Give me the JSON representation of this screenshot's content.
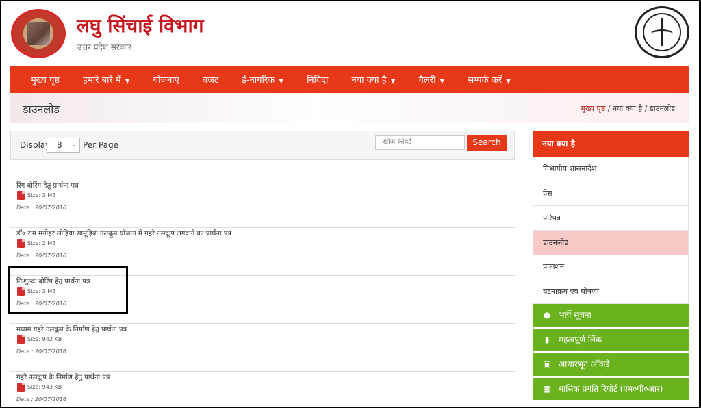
{
  "header": {
    "title": "लघु सिंचाई विभाग",
    "subtitle": "उत्तर प्रदेश सरकार"
  },
  "nav": {
    "items": [
      {
        "label": "मुख्य पृष्ठ",
        "dropdown": false
      },
      {
        "label": "हमारे बारे में",
        "dropdown": true
      },
      {
        "label": "योजनाएं",
        "dropdown": false
      },
      {
        "label": "बजट",
        "dropdown": false
      },
      {
        "label": "ई-नागरिक",
        "dropdown": true
      },
      {
        "label": "निविदा",
        "dropdown": false
      },
      {
        "label": "नया क्या है",
        "dropdown": true
      },
      {
        "label": "गैलरी",
        "dropdown": true
      },
      {
        "label": "सम्पर्क करें",
        "dropdown": true
      }
    ],
    "caret": "▼"
  },
  "page": {
    "title": "डाउनलोड",
    "breadcrumb": {
      "home": "मुख्य पृष्ठ",
      "rest": " / नया क्या है / डाउनलोड"
    }
  },
  "filter": {
    "display_label": "Display",
    "display_value": "8",
    "per_page_label": "Per Page",
    "search_placeholder": "खोज कीवर्ड",
    "search_button": "Search"
  },
  "documents": [
    {
      "title": "रिंग बोरिंग हेतु प्रार्थना पत्र",
      "size": "Size: 3 MB",
      "date": "Date : 20/07/2016"
    },
    {
      "title": "डॉ० राम मनोहर लोहिया सामूहिक नलकूप योजना में गहरे नलकूप लगवाने का प्रार्थना पत्र",
      "size": "Size: 2 MB",
      "date": "Date : 20/07/2016"
    },
    {
      "title": "निःशुल्क बोरिंग हेतु प्रार्थना पत्र",
      "size": "Size: 3 MB",
      "date": "Date : 20/07/2016"
    },
    {
      "title": "मध्यम गहरे नलकूप के निर्माण हेतु प्रार्थना पत्र",
      "size": "Size: 942 KB",
      "date": "Date : 20/07/2016"
    },
    {
      "title": "गहरे नलकूप के निर्माण हेतु प्रार्थना पत्र",
      "size": "Size: 943 KB",
      "date": "Date : 20/07/2016"
    }
  ],
  "sidebar": {
    "heading": "नया क्या है",
    "links": [
      "विभागीय शासनादेश",
      "प्रेस",
      "परिपत्र",
      "डाउनलोड",
      "प्रकाशन",
      "घटनाक्रम एवं घोषणा"
    ],
    "active_link": "डाउनलोड",
    "green_items": [
      {
        "label": "भर्ती सूचना",
        "icon": "user-icon"
      },
      {
        "label": "महत्वपूर्ण लिंक",
        "icon": "book-icon"
      },
      {
        "label": "आधारभूत आँकड़े",
        "icon": "save-icon"
      },
      {
        "label": "मासिक प्रगति रिपोर्ट (एम०पी०आर)",
        "icon": "grid-icon"
      }
    ]
  },
  "colors": {
    "accent": "#e8381a",
    "brand_title": "#c5161d",
    "green": "#6ab21e",
    "active_bg": "#f8c9c9"
  }
}
